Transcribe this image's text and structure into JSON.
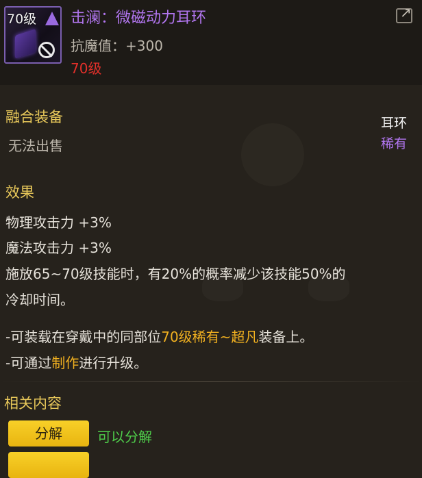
{
  "item": {
    "level_badge": "70级",
    "name": "击澜：微磁动力耳环",
    "attribute": "抗魔值：+300",
    "required_level": "70级",
    "icon": "earring-item-icon"
  },
  "details": {
    "category": "融合装备",
    "sell_status": "无法出售",
    "slot": "耳环",
    "rarity": "稀有"
  },
  "effects": {
    "title": "效果",
    "lines": [
      "物理攻击力 +3%",
      "魔法攻击力 +3%",
      "施放65~70级技能时，有20%的概率减少该技能50%的",
      "冷却时间。"
    ],
    "note1_pre": "-可装载在穿戴中的同部位",
    "note1_hl": "70级稀有~超凡",
    "note1_post": "装备上。",
    "note2_pre": "-可通过",
    "note2_hl": "制作",
    "note2_post": "进行升级。"
  },
  "related": {
    "title": "相关内容",
    "actions": [
      {
        "label": "分解",
        "note": "可以分解"
      }
    ]
  },
  "colors": {
    "item_name": "#b276f0",
    "section_title": "#e8c85a",
    "highlight": "#f0b020",
    "positive": "#4ecb4a",
    "warning": "#e3302a",
    "button": "#f0c018"
  }
}
